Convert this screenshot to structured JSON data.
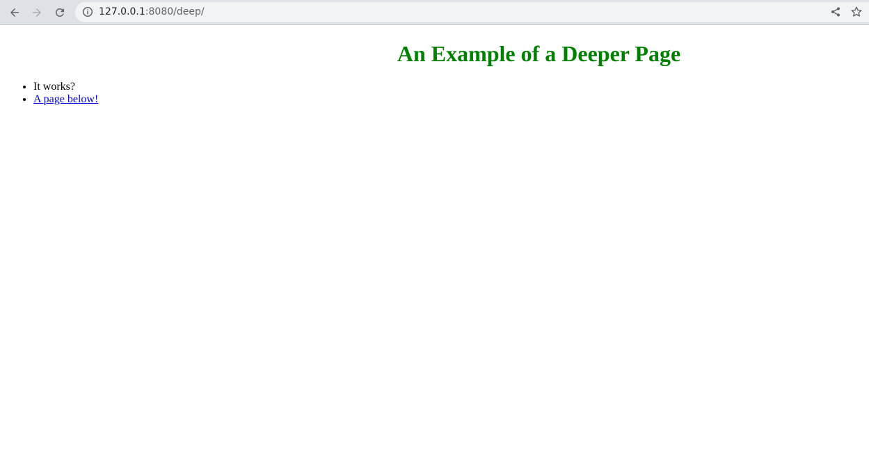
{
  "browser": {
    "url_host": "127.0.0.1",
    "url_rest": ":8080/deep/"
  },
  "page": {
    "title": "An Example of a Deeper Page",
    "title_color": "#008000",
    "items": [
      {
        "text": "It works?"
      },
      {
        "text": "A page below!",
        "link_color": "#0000ee"
      }
    ]
  }
}
